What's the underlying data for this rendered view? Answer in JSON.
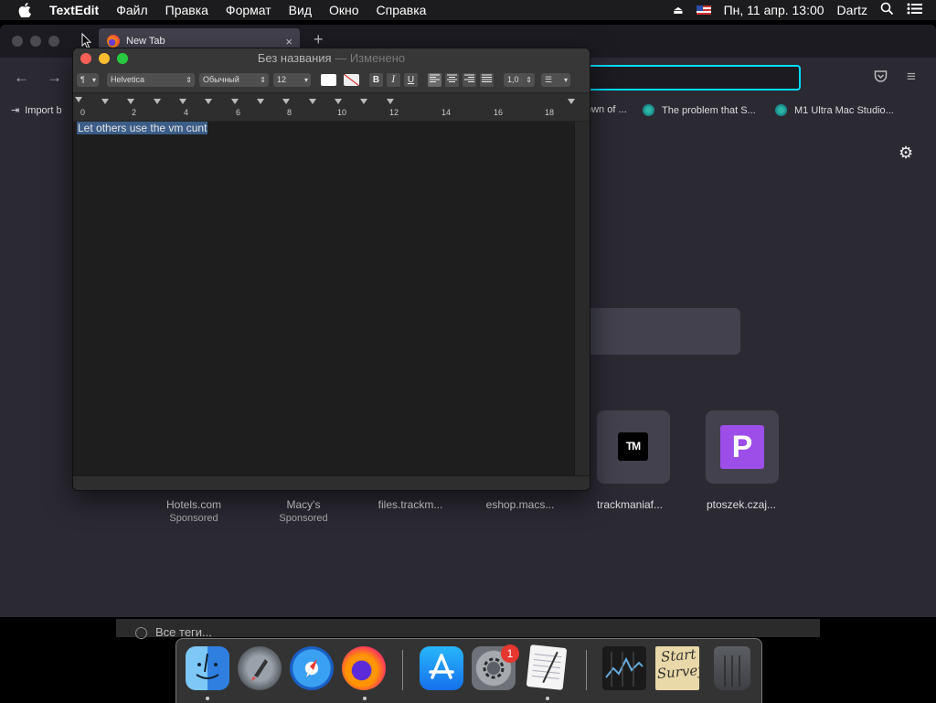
{
  "menubar": {
    "app_name": "TextEdit",
    "items": [
      "Файл",
      "Правка",
      "Формат",
      "Вид",
      "Окно",
      "Справка"
    ],
    "date_time": "Пн, 11 апр.  13:00",
    "user": "Dartz"
  },
  "firefox": {
    "tab_title": "New Tab",
    "bookmarks": [
      "Import b",
      "own of ...",
      "The problem that S...",
      "M1 Ultra Mac Studio..."
    ],
    "tiles": [
      {
        "label": "Hotels.com",
        "sub": "Sponsored"
      },
      {
        "label": "Macy's",
        "sub": "Sponsored"
      },
      {
        "label": "files.trackm...",
        "sub": ""
      },
      {
        "label": "eshop.macs...",
        "sub": ""
      },
      {
        "label": "trackmaniaf...",
        "sub": ""
      },
      {
        "label": "ptoszek.czaj...",
        "sub": ""
      }
    ],
    "tile_icon_tm": "TM",
    "tile_icon_p": "P"
  },
  "textedit": {
    "title": "Без названия",
    "edited": " — Изменено",
    "toolbar": {
      "paragraph": "¶",
      "font": "Helvetica",
      "style": "Обычный",
      "size": "12",
      "bold": "B",
      "italic": "I",
      "underline": "U",
      "spacing": "1,0"
    },
    "ruler_numbers": [
      "0",
      "2",
      "4",
      "6",
      "8",
      "10",
      "12",
      "14",
      "16",
      "18"
    ],
    "document_text": "Let others use the vm cunt"
  },
  "background_strip": {
    "label": "Все теги..."
  },
  "dock": {
    "apps": [
      "Finder",
      "Launchpad",
      "Safari",
      "Firefox",
      "App Store",
      "System Preferences",
      "TextEdit",
      "Stocks",
      "Start Survey",
      "Trash"
    ],
    "system_prefs_badge": "1",
    "sticky_text": "Start Survey"
  }
}
